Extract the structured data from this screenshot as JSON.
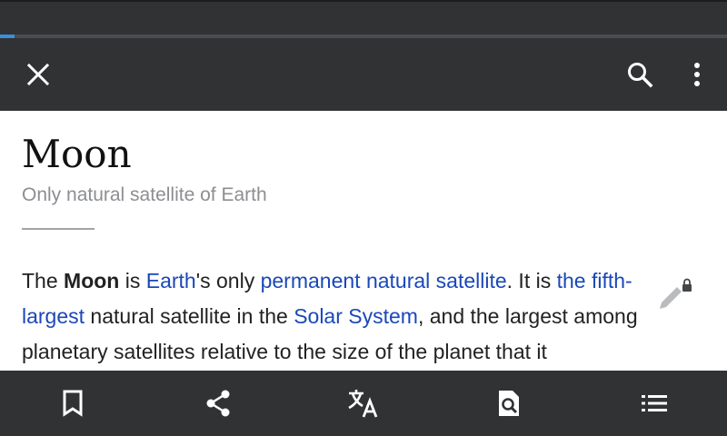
{
  "browser": {
    "load_progress_percent": 2
  },
  "toolbar": {
    "close_icon": "close-icon",
    "search_icon": "search-icon",
    "overflow_icon": "more-vertical-icon"
  },
  "article": {
    "title": "Moon",
    "description": "Only natural satellite of Earth",
    "paragraph": {
      "t1": "The ",
      "bold": "Moon",
      "t2": " is ",
      "link_earth": "Earth",
      "t3": "'s only ",
      "link_satellite": "permanent natural satellite",
      "t4": ". It is ",
      "link_fifth": "the fifth-largest",
      "t5": " natural satellite in the ",
      "link_solar": "Solar System",
      "t6": ", and the largest among planetary satellites relative to the size of the planet that it"
    }
  },
  "colors": {
    "toolbar_bg": "#313234",
    "progress_accent": "#3a8fd6",
    "link": "#1a48b8",
    "description_text": "#8c8e91"
  },
  "bottom_bar": {
    "icons": [
      "bookmark-icon",
      "share-icon",
      "translate-icon",
      "find-in-page-icon",
      "table-of-contents-icon"
    ]
  }
}
